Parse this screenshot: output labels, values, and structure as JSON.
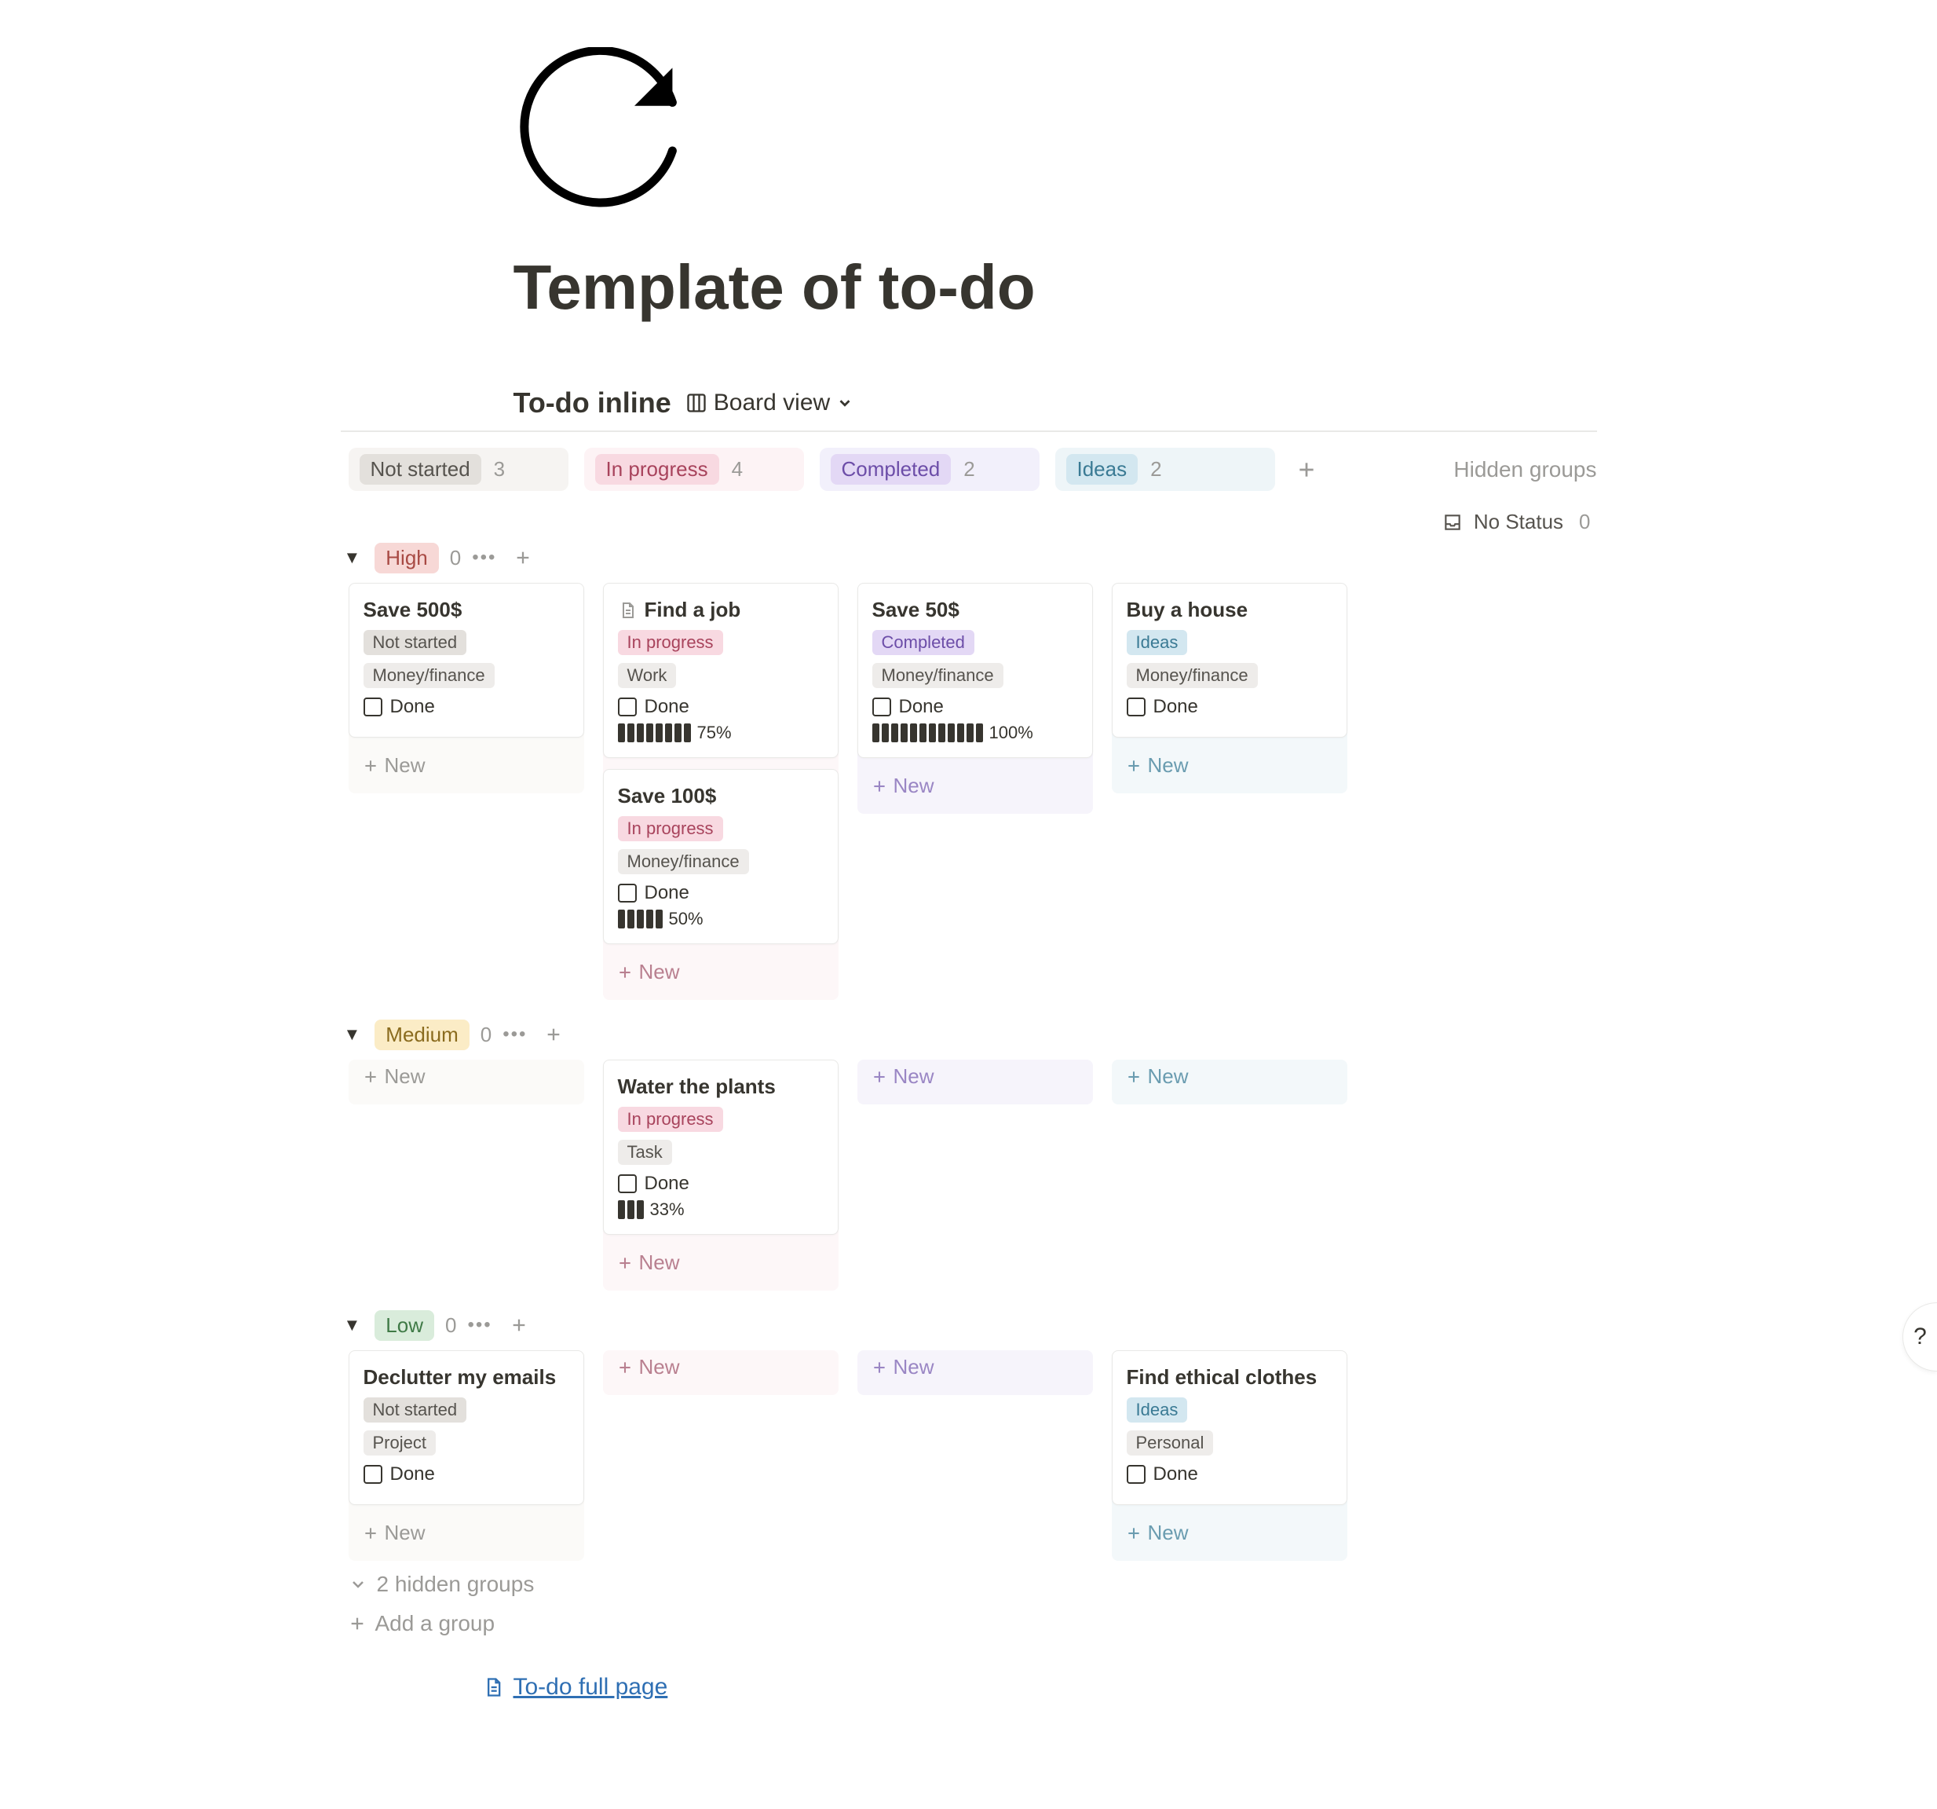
{
  "page": {
    "title": "Template of to-do"
  },
  "db": {
    "title": "To-do inline",
    "view_label": "Board view"
  },
  "columns": {
    "not_started": {
      "label": "Not started",
      "count": "3"
    },
    "in_progress": {
      "label": "In progress",
      "count": "4"
    },
    "completed": {
      "label": "Completed",
      "count": "2"
    },
    "ideas": {
      "label": "Ideas",
      "count": "2"
    }
  },
  "hidden_groups_label": "Hidden groups",
  "no_status": {
    "label": "No Status",
    "count": "0"
  },
  "groups": {
    "high": {
      "label": "High",
      "count": "0"
    },
    "medium": {
      "label": "Medium",
      "count": "0"
    },
    "low": {
      "label": "Low",
      "count": "0"
    }
  },
  "labels": {
    "new": "New",
    "done": "Done",
    "hidden_groups_count": "2 hidden groups",
    "add_group": "Add a group",
    "full_page": "To-do full page"
  },
  "tags": {
    "not_started": "Not started",
    "in_progress": "In progress",
    "completed": "Completed",
    "ideas": "Ideas",
    "money": "Money/finance",
    "work": "Work",
    "task": "Task",
    "project": "Project",
    "personal": "Personal"
  },
  "cards": {
    "save500": {
      "title": "Save 500$",
      "progress": null
    },
    "findjob": {
      "title": "Find a job",
      "progress": {
        "bars": 8,
        "pct": "75%"
      }
    },
    "save100": {
      "title": "Save 100$",
      "progress": {
        "bars": 5,
        "pct": "50%"
      }
    },
    "save50": {
      "title": "Save 50$",
      "progress": {
        "bars": 12,
        "pct": "100%"
      }
    },
    "buyhouse": {
      "title": "Buy a house"
    },
    "water": {
      "title": "Water the plants",
      "progress": {
        "bars": 3,
        "pct": "33%"
      }
    },
    "declutter": {
      "title": "Declutter my emails"
    },
    "ethical": {
      "title": "Find ethical clothes"
    }
  }
}
